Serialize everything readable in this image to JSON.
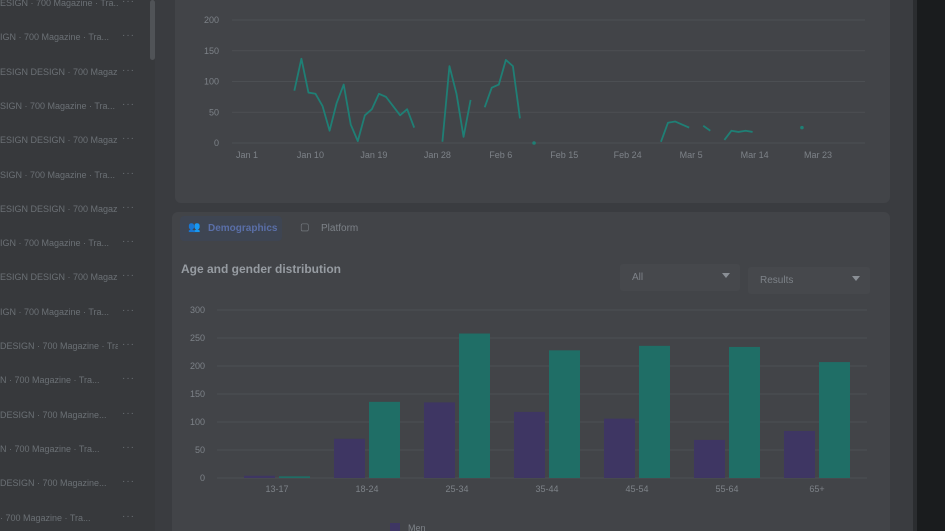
{
  "sidebar": {
    "items": [
      {
        "label": "ESIGN · 700 Magazine · Tra..."
      },
      {
        "label": "IGN · 700 Magazine · Tra..."
      },
      {
        "label": "ESIGN DESIGN · 700 Magazin..."
      },
      {
        "label": "SIGN · 700 Magazine · Tra..."
      },
      {
        "label": "ESIGN DESIGN · 700 Magazine..."
      },
      {
        "label": "SIGN · 700 Magazine · Tra..."
      },
      {
        "label": "ESIGN DESIGN · 700 Magazin..."
      },
      {
        "label": "IGN · 700 Magazine · Tra..."
      },
      {
        "label": "ESIGN DESIGN · 700 Magazin..."
      },
      {
        "label": "IGN · 700 Magazine · Tra..."
      },
      {
        "label": "DESIGN · 700 Magazine · Tra..."
      },
      {
        "label": "N · 700 Magazine · Tra..."
      },
      {
        "label": "DESIGN · 700 Magazine..."
      },
      {
        "label": "N · 700 Magazine · Tra..."
      },
      {
        "label": "DESIGN · 700 Magazine..."
      },
      {
        "label": "· 700 Magazine · Tra..."
      }
    ],
    "more_label": "···"
  },
  "tabs": {
    "demographics": "Demographics",
    "platform": "Platform"
  },
  "section_title": "Age and gender distribution",
  "filters": {
    "all": "All",
    "results": "Results"
  },
  "legend": {
    "men": "Men"
  },
  "colors": {
    "men": "#3e3663",
    "women": "#1f6e66",
    "line": "#1f7f75"
  },
  "chart_data": [
    {
      "type": "line",
      "x_ticks": [
        "Jan 1",
        "Jan 10",
        "Jan 19",
        "Jan 28",
        "Feb 6",
        "Feb 15",
        "Feb 24",
        "Mar 5",
        "Mar 14",
        "Mar 23"
      ],
      "y_ticks": [
        0,
        50,
        100,
        150,
        200
      ],
      "ylim": [
        0,
        200
      ],
      "series": [
        {
          "values": [
            [
              8,
              85
            ],
            [
              9,
              137
            ],
            [
              10,
              82
            ],
            [
              11,
              80
            ],
            [
              12,
              60
            ],
            [
              13,
              20
            ],
            [
              14,
              65
            ],
            [
              15,
              95
            ],
            [
              16,
              30
            ],
            [
              17,
              3
            ],
            [
              18,
              45
            ],
            [
              19,
              55
            ],
            [
              20,
              80
            ],
            [
              21,
              75
            ],
            [
              22,
              60
            ],
            [
              23,
              45
            ],
            [
              24,
              55
            ],
            [
              25,
              25
            ],
            [
              29,
              2
            ],
            [
              30,
              125
            ],
            [
              31,
              80
            ],
            [
              32,
              10
            ],
            [
              33,
              70
            ],
            [
              35,
              58
            ],
            [
              36,
              90
            ],
            [
              37,
              95
            ],
            [
              38,
              135
            ],
            [
              39,
              125
            ],
            [
              40,
              40
            ],
            [
              42,
              0
            ],
            [
              60,
              2
            ],
            [
              61,
              33
            ],
            [
              62,
              35
            ],
            [
              63,
              30
            ],
            [
              64,
              25
            ],
            [
              66,
              28
            ],
            [
              67,
              20
            ],
            [
              69,
              5
            ],
            [
              70,
              20
            ],
            [
              71,
              18
            ],
            [
              72,
              20
            ],
            [
              73,
              18
            ],
            [
              80,
              25
            ]
          ]
        }
      ]
    },
    {
      "type": "bar",
      "categories": [
        "13-17",
        "18-24",
        "25-34",
        "35-44",
        "45-54",
        "55-64",
        "65+"
      ],
      "y_ticks": [
        0,
        50,
        100,
        150,
        200,
        250,
        300
      ],
      "ylim": [
        0,
        300
      ],
      "series": [
        {
          "name": "Men",
          "values": [
            4,
            70,
            135,
            118,
            106,
            68,
            84
          ]
        },
        {
          "name": "Women",
          "values": [
            3,
            136,
            258,
            228,
            236,
            234,
            207
          ]
        }
      ]
    }
  ]
}
